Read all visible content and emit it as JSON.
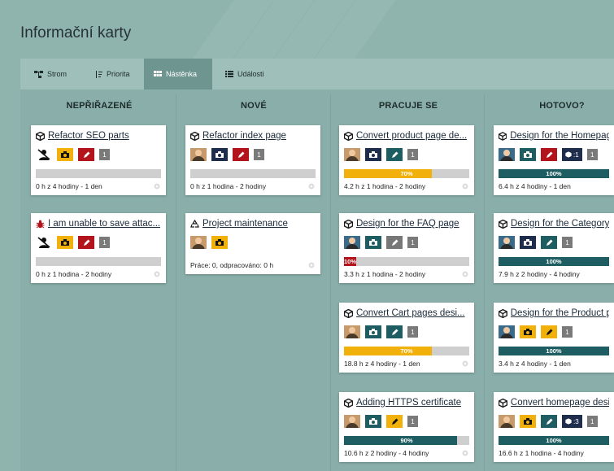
{
  "page": {
    "title": "Informační karty"
  },
  "tabs": [
    {
      "label": "Strom",
      "icon": "tree-icon",
      "active": false
    },
    {
      "label": "Priorita",
      "icon": "sort-icon",
      "active": false
    },
    {
      "label": "Nástěnka",
      "icon": "grid-icon",
      "active": true
    },
    {
      "label": "Události",
      "icon": "list-icon",
      "active": false
    }
  ],
  "columns": [
    {
      "title": "NEPŘIŘAZENÉ"
    },
    {
      "title": "NOVÉ"
    },
    {
      "title": "PRACUJE SE"
    },
    {
      "title": "HOTOVO?"
    }
  ],
  "colors": {
    "yellow": "#f2b10a",
    "red": "#b3131a",
    "teal": "#1e5e63",
    "navy": "#1f2d4d",
    "gray": "#777777"
  },
  "cards": [
    {
      "title": "Refactor SEO parts",
      "icon": "box-icon",
      "count": "1",
      "progress": 0,
      "progress_label": "",
      "footer": "0 h z 4 hodiny - 1 den"
    },
    {
      "title": "I am unable to save attac...",
      "icon": "bug-icon",
      "count": "1",
      "progress": 0,
      "progress_label": "",
      "footer": "0 h z 1 hodina - 2 hodiny"
    },
    {
      "title": "Refactor index page",
      "icon": "box-icon",
      "count": "1",
      "progress": 0,
      "progress_label": "",
      "footer": "0 h z 1 hodina - 2 hodiny"
    },
    {
      "title": "Project maintenance",
      "icon": "recycle-icon",
      "progress_label": "",
      "footer": "Práce: 0, odpracováno: 0 h"
    },
    {
      "title": "Convert product page de...",
      "icon": "box-icon",
      "count": "1",
      "progress": 70,
      "progress_label": "70%",
      "footer": "4.2 h z 1 hodina - 2 hodiny"
    },
    {
      "title": "Design for the FAQ page",
      "icon": "box-icon",
      "count": "1",
      "progress": 10,
      "progress_label": "10%",
      "footer": "3.3 h z 1 hodina - 2 hodiny"
    },
    {
      "title": "Convert Cart pages desi...",
      "icon": "box-icon",
      "count": "1",
      "progress": 70,
      "progress_label": "70%",
      "footer": "18.8 h z 4 hodiny - 1 den"
    },
    {
      "title": "Adding HTTPS certificate",
      "icon": "box-icon",
      "count": "1",
      "progress": 90,
      "progress_label": "90%",
      "footer": "10.6 h z 2 hodiny - 4 hodiny"
    },
    {
      "title": "Design for the Homepage",
      "icon": "box-icon",
      "subtasks": ":1",
      "count": "1",
      "progress": 100,
      "progress_label": "100%",
      "footer": "6.4 h z 4 hodiny - 1 den"
    },
    {
      "title": "Design for the Category",
      "icon": "box-icon",
      "count": "1",
      "progress": 100,
      "progress_label": "100%",
      "footer": "7.9 h z 2 hodiny - 4 hodiny"
    },
    {
      "title": "Design for the Product p",
      "icon": "box-icon",
      "count": "1",
      "progress": 100,
      "progress_label": "100%",
      "footer": "3.4 h z 4 hodiny - 1 den"
    },
    {
      "title": "Convert homepage desi",
      "icon": "box-icon",
      "subtasks": ":3",
      "count": "1",
      "progress": 100,
      "progress_label": "100%",
      "footer": "16.6 h z 1 hodina - 4 hodiny"
    }
  ]
}
